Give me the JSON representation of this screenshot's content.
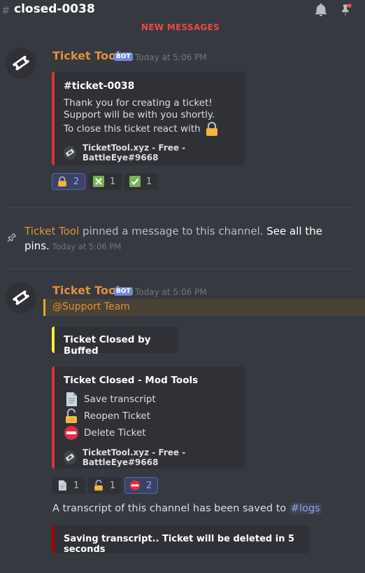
{
  "header": {
    "hash_glyph": "#",
    "channel_name": "closed-0038",
    "more_glyph": "⋮"
  },
  "divider": {
    "label": "NEW MESSAGES"
  },
  "colors": {
    "accent_orange": "#e0903d",
    "embed_red": "#d63737",
    "embed_yellow": "#ffeb3b",
    "embed_dark_red": "#a80000",
    "blurple": "#7289da"
  },
  "messages": [
    {
      "author": "Ticket Tool",
      "bot_tag": "BOT",
      "timestamp": "Today at 5:06 PM",
      "embed": {
        "title": "#ticket-0038",
        "lines": [
          "Thank you for creating a ticket!",
          "Support will be with you shortly.",
          "To close this ticket react with"
        ],
        "footer": "TicketTool.xyz - Free - BattleEye#9668"
      },
      "reactions": [
        {
          "emoji": "lock-icon",
          "count": "2"
        },
        {
          "emoji": "cross-mark-icon",
          "count": "1"
        },
        {
          "emoji": "check-mark-icon",
          "count": "1"
        }
      ]
    },
    {
      "system": true,
      "author": "Ticket Tool",
      "text": " pinned a message to this channel. ",
      "link": "See all the pins.",
      "timestamp": "Today at 5:06 PM"
    },
    {
      "author": "Ticket Tool",
      "bot_tag": "BOT",
      "timestamp": "Today at 5:06 PM",
      "mention": "@Support Team",
      "embed_closed_by": {
        "title": "Ticket Closed by Buffed"
      },
      "embed_mod_tools": {
        "title": "Ticket Closed - Mod Tools",
        "items": [
          {
            "icon": "document-icon",
            "label": "Save transcript"
          },
          {
            "icon": "unlock-icon",
            "label": "Reopen Ticket"
          },
          {
            "icon": "no-entry-icon",
            "label": "Delete Ticket"
          }
        ],
        "footer": "TicketTool.xyz - Free - BattleEye#9668"
      },
      "reactions": [
        {
          "emoji": "document-icon",
          "count": "1"
        },
        {
          "emoji": "unlock-icon",
          "count": "1"
        },
        {
          "emoji": "no-entry-icon",
          "count": "2"
        }
      ],
      "transcript_text": "A transcript of this channel has been saved to ",
      "transcript_channel": "#logs",
      "embed_saving": {
        "title": "Saving transcript.. Ticket will be deleted in 5 seconds"
      }
    }
  ]
}
